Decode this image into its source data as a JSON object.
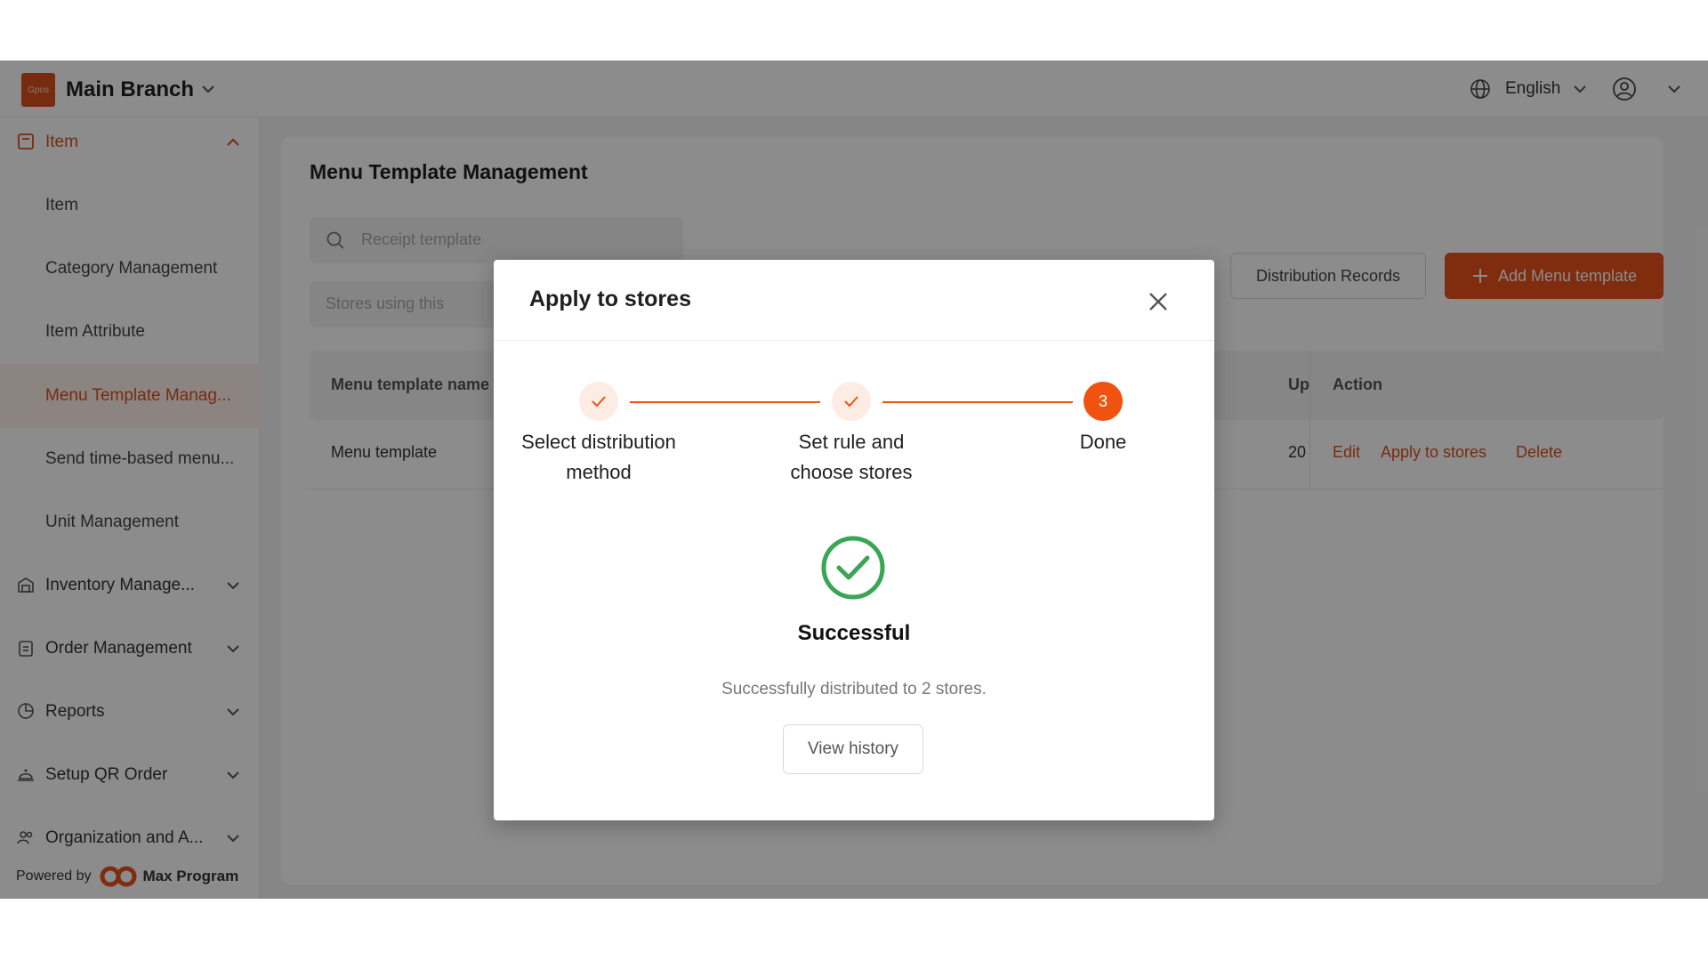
{
  "topbar": {
    "logo_text": "Gpos",
    "branch_name": "Main Branch",
    "language": "English"
  },
  "sidebar": {
    "item_group": "Item",
    "sub_items": [
      "Item",
      "Category Management",
      "Item Attribute",
      "Menu Template Manag...",
      "Send time-based menu...",
      "Unit Management"
    ],
    "groups": [
      "Inventory Manage...",
      "Order Management",
      "Reports",
      "Setup QR Order",
      "Organization and A..."
    ],
    "powered_by": "Powered by",
    "powered_brand": "Max Program"
  },
  "main": {
    "title": "Menu Template Management",
    "search_placeholder": "Receipt template",
    "filter_placeholder": "Stores using this",
    "distribution_button": "Distribution Records",
    "add_button": "Add Menu template",
    "table": {
      "headers": [
        "Menu template name",
        "Up",
        "Action"
      ],
      "rows": [
        {
          "name": "Menu template",
          "updated": "20",
          "actions": [
            "Edit",
            "Apply to stores",
            "Delete"
          ]
        }
      ]
    }
  },
  "modal": {
    "title": "Apply to stores",
    "steps": [
      {
        "label": "Select distribution method",
        "status": "done"
      },
      {
        "label": "Set rule and choose stores",
        "status": "done"
      },
      {
        "label": "Done",
        "status": "current",
        "number": "3"
      }
    ],
    "success_title": "Successful",
    "success_desc": "Successfully distributed to 2 stores.",
    "history_button": "View history"
  },
  "colors": {
    "accent": "#e8501c",
    "success": "#3aa655"
  }
}
